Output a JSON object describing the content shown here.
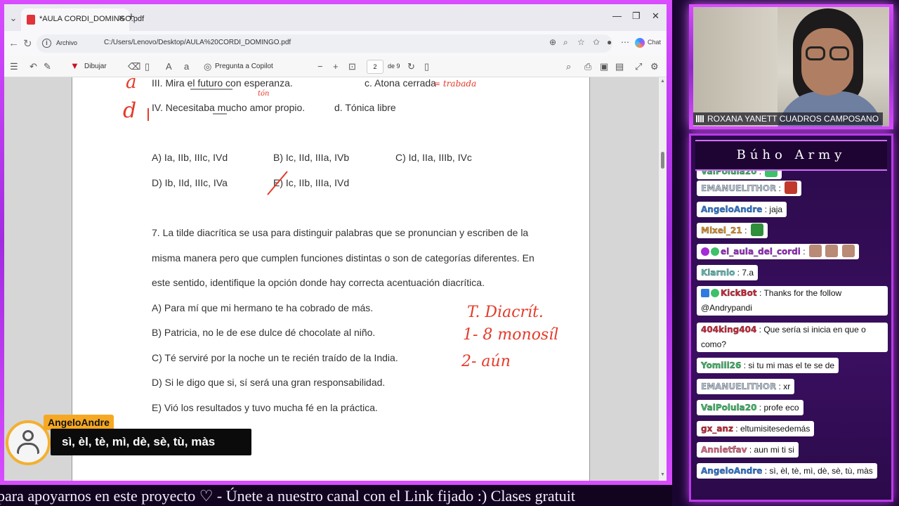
{
  "browser": {
    "tab_title": "*AULA CORDI_DOMINGO.pdf",
    "url_label": "Archivo",
    "url": "C:/Users/Lenovo/Desktop/AULA%20CORDI_DOMINGO.pdf",
    "copilot_label": "Chat",
    "toolbar": {
      "draw_label": "Dibujar",
      "copilot_question": "Pregunta a Copilot",
      "page_current": "2",
      "page_total": "de 9"
    }
  },
  "document": {
    "item_iii": "III. Mira el futuro con esperanza.",
    "item_c": "c. Atona cerrada",
    "item_iv": "IV. Necesitaba mucho amor propio.",
    "item_d": "d. Tónica libre",
    "options_row1": [
      "A) Ia, IIb, IIIc, IVd",
      "B) Ic, IId, IIIa, IVb",
      "C) Id, IIa, IIIb, IVc"
    ],
    "options_row2": [
      "D) Ib, IId, IIIc, IVa",
      "E) Ic, IIb, IIIa, IVd"
    ],
    "q7_lines": [
      "7. La tilde diacrítica se usa para distinguir palabras que se pronuncian y escriben de la",
      "misma manera pero que cumplen funciones distintas o son de categorías diferentes. En",
      "este sentido, identifique la opción donde hay correcta acentuación diacrítica."
    ],
    "q7_options": [
      "A) Para mí que mi hermano te ha cobrado de más.",
      "B) Patricia, no le de ese dulce dé chocolate al niño.",
      "C) Té serviré por la noche un te recién traído de la India.",
      "D) Si le digo que si, sí será una gran responsabilidad.",
      "E) Vió los resultados y tuvo mucha fé en la práctica."
    ],
    "handwriting": {
      "mark_a": "a",
      "mark_d": "d",
      "ton": "tón",
      "trabada": "= trabada",
      "note1": "T. Diacrít.",
      "note2": "1- 8 monosíl",
      "note3": "2- aún"
    }
  },
  "overlay_chat": {
    "username": "AngeloAndre",
    "message": "sì, èl, tè, mì, dè, sè, tù, màs"
  },
  "ticker": "para apoyarnos en este proyecto ♡   -   Únete a nuestro canal con el Link fijado :)  Clases gratuit",
  "webcam": {
    "name": "ROXANA YANETT CUADROS CAMPOSANO"
  },
  "chat": {
    "title": "Búho Army",
    "messages": [
      {
        "user": "ValPolula20",
        "color": "#3fc06a",
        "text": ""
      },
      {
        "user": "EMANUELITHOR",
        "color": "#b8c6d8",
        "text": ""
      },
      {
        "user": "AngeloAndre",
        "color": "#2f7be0",
        "text": "jaja"
      },
      {
        "user": "Mixel_21",
        "color": "#e8962a",
        "text": ""
      },
      {
        "user": "el_aula_del_cordi",
        "color": "#a52bd6",
        "text": ""
      },
      {
        "user": "Kiarnio",
        "color": "#5fc4c0",
        "text": "7.a"
      },
      {
        "user": "KickBot",
        "color": "#d8263a",
        "text": "Thanks for the follow @Andrypandi"
      },
      {
        "user": "404king404",
        "color": "#d8263a",
        "text": "Que sería si inicia en que o como?"
      },
      {
        "user": "Yomiii26",
        "color": "#3fc06a",
        "text": "si tu mi mas el te se de"
      },
      {
        "user": "EMANUELITHOR",
        "color": "#b8c6d8",
        "text": "xr"
      },
      {
        "user": "ValPolula20",
        "color": "#3fc06a",
        "text": "profe eco"
      },
      {
        "user": "gx_anz",
        "color": "#d8263a",
        "text": "eltumisitesedemás"
      },
      {
        "user": "Annietfav",
        "color": "#e86a8a",
        "text": "aun mi ti si"
      },
      {
        "user": "AngeloAndre",
        "color": "#2f7be0",
        "text": "sì, èl, tè, mì, dè, sè, tù, màs"
      }
    ]
  }
}
